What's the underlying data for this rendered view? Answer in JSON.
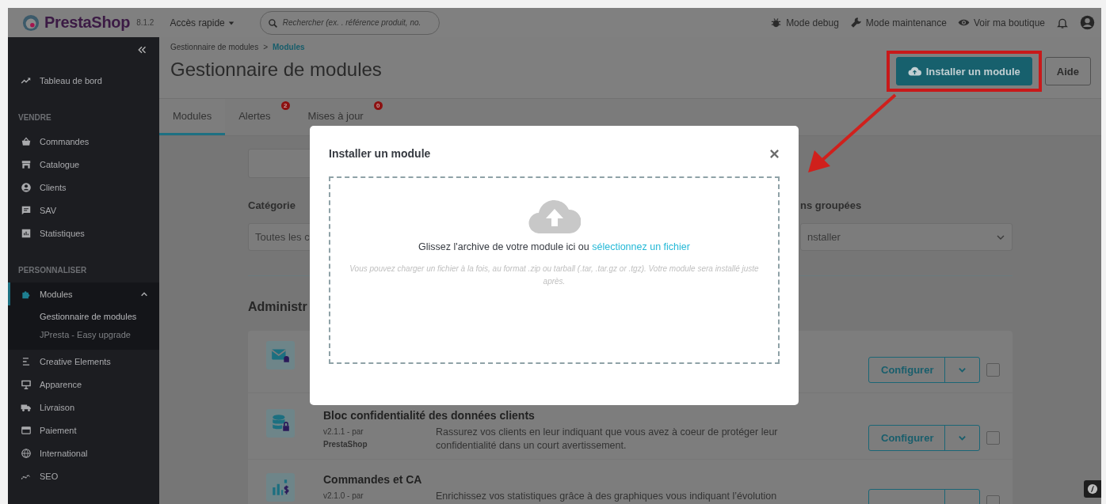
{
  "header": {
    "logo": "PrestaShop",
    "version": "8.1.2",
    "quick_access": "Accès rapide",
    "search": {
      "placeholder": "Rechercher (ex. . référence produit, no."
    },
    "links": [
      {
        "label": "Mode debug"
      },
      {
        "label": "Mode maintenance"
      },
      {
        "label": "Voir ma boutique"
      }
    ]
  },
  "sidebar": {
    "items": [
      {
        "kind": "link",
        "label": "Tableau de bord",
        "selected": false
      },
      {
        "kind": "section",
        "label": "VENDRE"
      },
      {
        "kind": "link",
        "label": "Commandes",
        "selected": false
      },
      {
        "kind": "link",
        "label": "Catalogue",
        "selected": false
      },
      {
        "kind": "link",
        "label": "Clients",
        "selected": false
      },
      {
        "kind": "link",
        "label": "SAV",
        "selected": false
      },
      {
        "kind": "link",
        "label": "Statistiques",
        "selected": false
      },
      {
        "kind": "section",
        "label": "PERSONNALISER"
      },
      {
        "kind": "link",
        "label": "Modules",
        "selected": true,
        "expanded": true,
        "children": [
          {
            "label": "Gestionnaire de modules",
            "selected": true
          },
          {
            "label": "JPresta - Easy upgrade",
            "selected": false
          }
        ]
      },
      {
        "kind": "link",
        "label": "Creative Elements",
        "selected": false
      },
      {
        "kind": "link",
        "label": "Apparence",
        "selected": false
      },
      {
        "kind": "link",
        "label": "Livraison",
        "selected": false
      },
      {
        "kind": "link",
        "label": "Paiement",
        "selected": false
      },
      {
        "kind": "link",
        "label": "International",
        "selected": false
      },
      {
        "kind": "link",
        "label": "SEO",
        "selected": false
      }
    ]
  },
  "breadcrumb": {
    "items": [
      "Gestionnaire de modules",
      "Modules"
    ],
    "separator": ">"
  },
  "page_title": "Gestionnaire de modules",
  "toolbar_buttons": [
    {
      "label": "Installer un module",
      "kind": "primary",
      "highlighted": true
    },
    {
      "label": "Aide",
      "kind": "outline",
      "highlighted": false
    }
  ],
  "tabs": [
    {
      "label": "Modules",
      "selected": true
    },
    {
      "label": "Alertes",
      "selected": false,
      "badge": "2"
    },
    {
      "label": "Mises à jour",
      "selected": false,
      "badge": "0"
    }
  ],
  "filters": [
    {
      "label": "Catégorie",
      "value": "Toutes les c"
    },
    {
      "label": "ns groupées",
      "value": "nstaller"
    }
  ],
  "section_title": "Administr",
  "modules": [
    {
      "action": "Configurer",
      "checked": false
    },
    {
      "title": "Bloc confidentialité des données clients",
      "version": "v2.1.1 - par",
      "author": "PrestaShop",
      "description": "Rassurez vos clients en leur indiquant que vous avez à coeur de protéger leur confidentialité dans un court avertissement.",
      "action": "Configurer",
      "checked": false
    },
    {
      "title": "Commandes et CA",
      "version": "v2.1.0 - par",
      "description": "Enrichissez vos statistiques grâce à des graphiques vous indiquant l’évolution",
      "checked": false
    }
  ],
  "modal": {
    "title": "Installer un module",
    "drop_text": "Glissez l'archive de votre module ici ou",
    "link": "sélectionnez un fichier",
    "hint": "Vous pouvez charger un fichier à la fois, au format .zip ou tarball (.tar, .tar.gz or .tgz). Votre module sera installé juste après."
  }
}
